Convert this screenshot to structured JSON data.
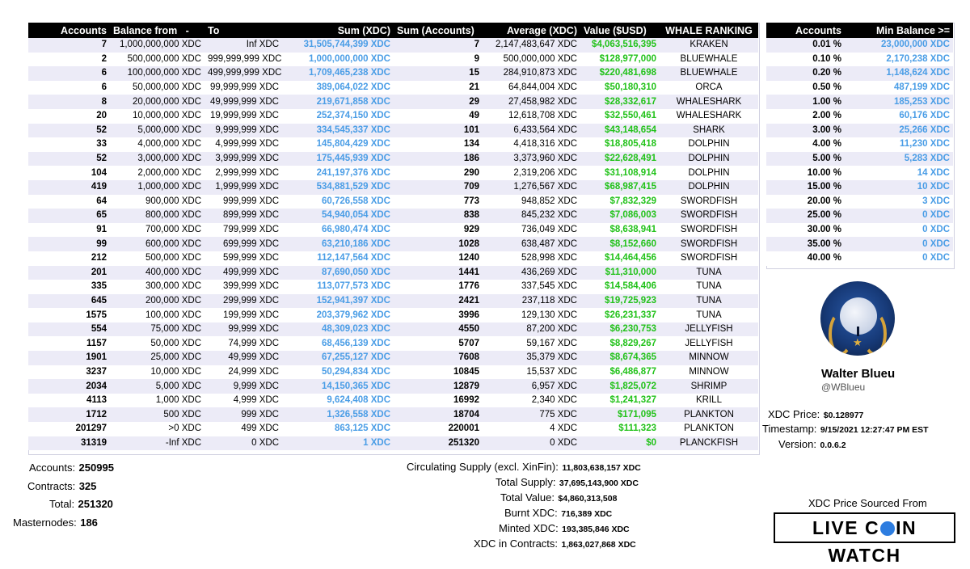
{
  "main_table": {
    "headers": {
      "accounts": "Accounts",
      "balance_from": "Balance from",
      "dash": "-",
      "to": "To",
      "sum_xdc": "Sum (XDC)",
      "sum_accounts": "Sum (Accounts)",
      "average": "Average (XDC)",
      "value_usd": "Value ($USD)",
      "whale_ranking": "WHALE RANKING"
    },
    "rows": [
      {
        "accounts": "7",
        "from": "1,000,000,000 XDC",
        "to": "Inf XDC",
        "sum": "31,505,744,399 XDC",
        "sum_accounts": "7",
        "avg": "2,147,483,647 XDC",
        "usd": "$4,063,516,395",
        "rank": "KRAKEN"
      },
      {
        "accounts": "2",
        "from": "500,000,000 XDC",
        "to": "999,999,999 XDC",
        "sum": "1,000,000,000 XDC",
        "sum_accounts": "9",
        "avg": "500,000,000 XDC",
        "usd": "$128,977,000",
        "rank": "BLUEWHALE"
      },
      {
        "accounts": "6",
        "from": "100,000,000 XDC",
        "to": "499,999,999 XDC",
        "sum": "1,709,465,238 XDC",
        "sum_accounts": "15",
        "avg": "284,910,873 XDC",
        "usd": "$220,481,698",
        "rank": "BLUEWHALE"
      },
      {
        "accounts": "6",
        "from": "50,000,000 XDC",
        "to": "99,999,999 XDC",
        "sum": "389,064,022 XDC",
        "sum_accounts": "21",
        "avg": "64,844,004 XDC",
        "usd": "$50,180,310",
        "rank": "ORCA"
      },
      {
        "accounts": "8",
        "from": "20,000,000 XDC",
        "to": "49,999,999 XDC",
        "sum": "219,671,858 XDC",
        "sum_accounts": "29",
        "avg": "27,458,982 XDC",
        "usd": "$28,332,617",
        "rank": "WHALESHARK"
      },
      {
        "accounts": "20",
        "from": "10,000,000 XDC",
        "to": "19,999,999 XDC",
        "sum": "252,374,150 XDC",
        "sum_accounts": "49",
        "avg": "12,618,708 XDC",
        "usd": "$32,550,461",
        "rank": "WHALESHARK"
      },
      {
        "accounts": "52",
        "from": "5,000,000 XDC",
        "to": "9,999,999 XDC",
        "sum": "334,545,337 XDC",
        "sum_accounts": "101",
        "avg": "6,433,564 XDC",
        "usd": "$43,148,654",
        "rank": "SHARK"
      },
      {
        "accounts": "33",
        "from": "4,000,000 XDC",
        "to": "4,999,999 XDC",
        "sum": "145,804,429 XDC",
        "sum_accounts": "134",
        "avg": "4,418,316 XDC",
        "usd": "$18,805,418",
        "rank": "DOLPHIN"
      },
      {
        "accounts": "52",
        "from": "3,000,000 XDC",
        "to": "3,999,999 XDC",
        "sum": "175,445,939 XDC",
        "sum_accounts": "186",
        "avg": "3,373,960 XDC",
        "usd": "$22,628,491",
        "rank": "DOLPHIN"
      },
      {
        "accounts": "104",
        "from": "2,000,000 XDC",
        "to": "2,999,999 XDC",
        "sum": "241,197,376 XDC",
        "sum_accounts": "290",
        "avg": "2,319,206 XDC",
        "usd": "$31,108,914",
        "rank": "DOLPHIN"
      },
      {
        "accounts": "419",
        "from": "1,000,000 XDC",
        "to": "1,999,999 XDC",
        "sum": "534,881,529 XDC",
        "sum_accounts": "709",
        "avg": "1,276,567 XDC",
        "usd": "$68,987,415",
        "rank": "DOLPHIN"
      },
      {
        "accounts": "64",
        "from": "900,000 XDC",
        "to": "999,999 XDC",
        "sum": "60,726,558 XDC",
        "sum_accounts": "773",
        "avg": "948,852 XDC",
        "usd": "$7,832,329",
        "rank": "SWORDFISH"
      },
      {
        "accounts": "65",
        "from": "800,000 XDC",
        "to": "899,999 XDC",
        "sum": "54,940,054 XDC",
        "sum_accounts": "838",
        "avg": "845,232 XDC",
        "usd": "$7,086,003",
        "rank": "SWORDFISH"
      },
      {
        "accounts": "91",
        "from": "700,000 XDC",
        "to": "799,999 XDC",
        "sum": "66,980,474 XDC",
        "sum_accounts": "929",
        "avg": "736,049 XDC",
        "usd": "$8,638,941",
        "rank": "SWORDFISH"
      },
      {
        "accounts": "99",
        "from": "600,000 XDC",
        "to": "699,999 XDC",
        "sum": "63,210,186 XDC",
        "sum_accounts": "1028",
        "avg": "638,487 XDC",
        "usd": "$8,152,660",
        "rank": "SWORDFISH"
      },
      {
        "accounts": "212",
        "from": "500,000 XDC",
        "to": "599,999 XDC",
        "sum": "112,147,564 XDC",
        "sum_accounts": "1240",
        "avg": "528,998 XDC",
        "usd": "$14,464,456",
        "rank": "SWORDFISH"
      },
      {
        "accounts": "201",
        "from": "400,000 XDC",
        "to": "499,999 XDC",
        "sum": "87,690,050 XDC",
        "sum_accounts": "1441",
        "avg": "436,269 XDC",
        "usd": "$11,310,000",
        "rank": "TUNA"
      },
      {
        "accounts": "335",
        "from": "300,000 XDC",
        "to": "399,999 XDC",
        "sum": "113,077,573 XDC",
        "sum_accounts": "1776",
        "avg": "337,545 XDC",
        "usd": "$14,584,406",
        "rank": "TUNA"
      },
      {
        "accounts": "645",
        "from": "200,000 XDC",
        "to": "299,999 XDC",
        "sum": "152,941,397 XDC",
        "sum_accounts": "2421",
        "avg": "237,118 XDC",
        "usd": "$19,725,923",
        "rank": "TUNA"
      },
      {
        "accounts": "1575",
        "from": "100,000 XDC",
        "to": "199,999 XDC",
        "sum": "203,379,962 XDC",
        "sum_accounts": "3996",
        "avg": "129,130 XDC",
        "usd": "$26,231,337",
        "rank": "TUNA"
      },
      {
        "accounts": "554",
        "from": "75,000 XDC",
        "to": "99,999 XDC",
        "sum": "48,309,023 XDC",
        "sum_accounts": "4550",
        "avg": "87,200 XDC",
        "usd": "$6,230,753",
        "rank": "JELLYFISH"
      },
      {
        "accounts": "1157",
        "from": "50,000 XDC",
        "to": "74,999 XDC",
        "sum": "68,456,139 XDC",
        "sum_accounts": "5707",
        "avg": "59,167 XDC",
        "usd": "$8,829,267",
        "rank": "JELLYFISH"
      },
      {
        "accounts": "1901",
        "from": "25,000 XDC",
        "to": "49,999 XDC",
        "sum": "67,255,127 XDC",
        "sum_accounts": "7608",
        "avg": "35,379 XDC",
        "usd": "$8,674,365",
        "rank": "MINNOW"
      },
      {
        "accounts": "3237",
        "from": "10,000 XDC",
        "to": "24,999 XDC",
        "sum": "50,294,834 XDC",
        "sum_accounts": "10845",
        "avg": "15,537 XDC",
        "usd": "$6,486,877",
        "rank": "MINNOW"
      },
      {
        "accounts": "2034",
        "from": "5,000 XDC",
        "to": "9,999 XDC",
        "sum": "14,150,365 XDC",
        "sum_accounts": "12879",
        "avg": "6,957 XDC",
        "usd": "$1,825,072",
        "rank": "SHRIMP"
      },
      {
        "accounts": "4113",
        "from": "1,000 XDC",
        "to": "4,999 XDC",
        "sum": "9,624,408 XDC",
        "sum_accounts": "16992",
        "avg": "2,340 XDC",
        "usd": "$1,241,327",
        "rank": "KRILL"
      },
      {
        "accounts": "1712",
        "from": "500 XDC",
        "to": "999 XDC",
        "sum": "1,326,558 XDC",
        "sum_accounts": "18704",
        "avg": "775 XDC",
        "usd": "$171,095",
        "rank": "PLANKTON"
      },
      {
        "accounts": "201297",
        "from": ">0 XDC",
        "to": "499 XDC",
        "sum": "863,125 XDC",
        "sum_accounts": "220001",
        "avg": "4 XDC",
        "usd": "$111,323",
        "rank": "PLANKTON"
      },
      {
        "accounts": "31319",
        "from": "-Inf XDC",
        "to": "0 XDC",
        "sum": "1 XDC",
        "sum_accounts": "251320",
        "avg": "0 XDC",
        "usd": "$0",
        "rank": "PLANCKFISH"
      }
    ]
  },
  "side_table": {
    "headers": {
      "accounts": "Accounts",
      "min_balance": "Min Balance >="
    },
    "rows": [
      {
        "pct": "0.01 %",
        "min": "23,000,000 XDC"
      },
      {
        "pct": "0.10 %",
        "min": "2,170,238 XDC"
      },
      {
        "pct": "0.20 %",
        "min": "1,148,624 XDC"
      },
      {
        "pct": "0.50 %",
        "min": "487,199 XDC"
      },
      {
        "pct": "1.00 %",
        "min": "185,253 XDC"
      },
      {
        "pct": "2.00 %",
        "min": "60,176 XDC"
      },
      {
        "pct": "3.00 %",
        "min": "25,266 XDC"
      },
      {
        "pct": "4.00 %",
        "min": "11,230 XDC"
      },
      {
        "pct": "5.00 %",
        "min": "5,283 XDC"
      },
      {
        "pct": "10.00 %",
        "min": "14 XDC"
      },
      {
        "pct": "15.00 %",
        "min": "10 XDC"
      },
      {
        "pct": "20.00 %",
        "min": "3 XDC"
      },
      {
        "pct": "25.00 %",
        "min": "0 XDC"
      },
      {
        "pct": "30.00 %",
        "min": "0 XDC"
      },
      {
        "pct": "35.00 %",
        "min": "0 XDC"
      },
      {
        "pct": "40.00 %",
        "min": "0 XDC"
      }
    ]
  },
  "profile": {
    "name": "Walter Blueu",
    "handle": "@WBlueu",
    "avatar_icon": "moon-laurel-avatar-icon"
  },
  "info": {
    "price_label": "XDC Price:",
    "price_value": "$0.128977",
    "timestamp_label": "Timestamp:",
    "timestamp_value": "9/15/2021 12:27:47 PM EST",
    "version_label": "Version:",
    "version_value": "0.0.6.2"
  },
  "totals": {
    "accounts_label": "Accounts:",
    "accounts_value": "250995",
    "contracts_label": "Contracts:",
    "contracts_value": "325",
    "total_label": "Total:",
    "total_value": "251320",
    "masternodes_label": "Masternodes:",
    "masternodes_value": "186"
  },
  "supply": {
    "circ_label": "Circulating Supply (excl. XinFin):",
    "circ_value": "11,803,638,157 XDC",
    "total_label": "Total Supply:",
    "total_value": "37,695,143,900 XDC",
    "value_label": "Total Value:",
    "value_value": "$4,860,313,508",
    "burnt_label": "Burnt XDC:",
    "burnt_value": "716,389 XDC",
    "minted_label": "Minted XDC:",
    "minted_value": "193,385,846 XDC",
    "contracts_label": "XDC in Contracts:",
    "contracts_value": "1,863,027,868 XDC"
  },
  "source": {
    "label": "XDC Price Sourced From",
    "logo_text_left": "LIVE C",
    "logo_text_right": "IN WATCH",
    "logo_icon": "coin-icon"
  },
  "colors": {
    "header_bg": "#000000",
    "row_alt": "#ecebf7",
    "sum_blue": "#4a9de6",
    "usd_green": "#22c21a"
  }
}
